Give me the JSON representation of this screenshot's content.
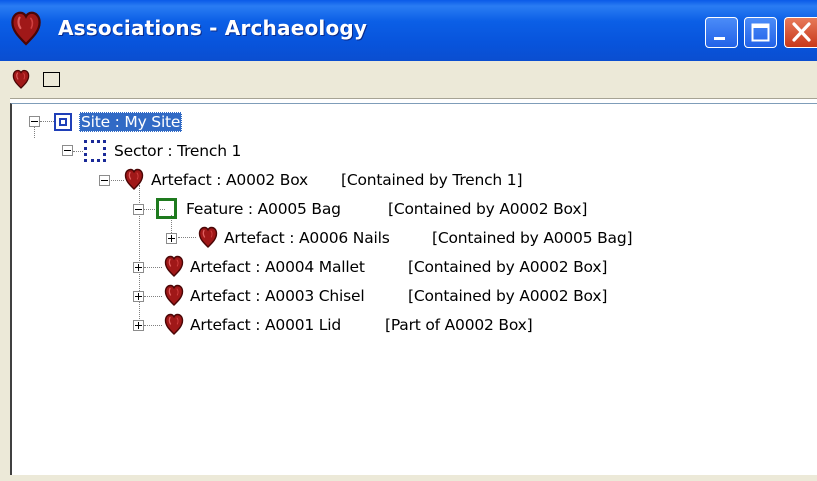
{
  "window": {
    "title": "Associations - Archaeology"
  },
  "toolbar": {
    "buttons": [
      {
        "icon": "artefact-heart-icon"
      },
      {
        "icon": "square-outline-icon"
      }
    ]
  },
  "tree": {
    "nodes": [
      {
        "label": "Site : My Site",
        "relation": "",
        "expander": "minus",
        "icon": "site-icon",
        "selected": true
      },
      {
        "label": "Sector : Trench 1",
        "relation": "",
        "expander": "minus",
        "icon": "sector-icon"
      },
      {
        "label": "Artefact : A0002 Box",
        "relation": "[Contained by Trench 1]",
        "expander": "minus",
        "icon": "artefact-icon"
      },
      {
        "label": "Feature : A0005 Bag",
        "relation": "[Contained by A0002 Box]",
        "expander": "minus",
        "icon": "feature-icon"
      },
      {
        "label": "Artefact : A0006 Nails",
        "relation": "[Contained by A0005 Bag]",
        "expander": "plus",
        "icon": "artefact-icon"
      },
      {
        "label": "Artefact : A0004 Mallet",
        "relation": "[Contained by A0002 Box]",
        "expander": "plus",
        "icon": "artefact-icon"
      },
      {
        "label": "Artefact : A0003 Chisel",
        "relation": "[Contained by A0002 Box]",
        "expander": "plus",
        "icon": "artefact-icon"
      },
      {
        "label": "Artefact : A0001 Lid",
        "relation": "[Part of A0002 Box]",
        "expander": "plus",
        "icon": "artefact-icon"
      }
    ]
  },
  "colors": {
    "title_bar": "#0a5ae8",
    "selection": "#316ac5",
    "site_icon": "#1f3fb8",
    "sector_icon": "#1a2a98",
    "feature_icon": "#1e7a1e",
    "artefact_icon": "#a01818",
    "close_button": "#c8381b"
  }
}
